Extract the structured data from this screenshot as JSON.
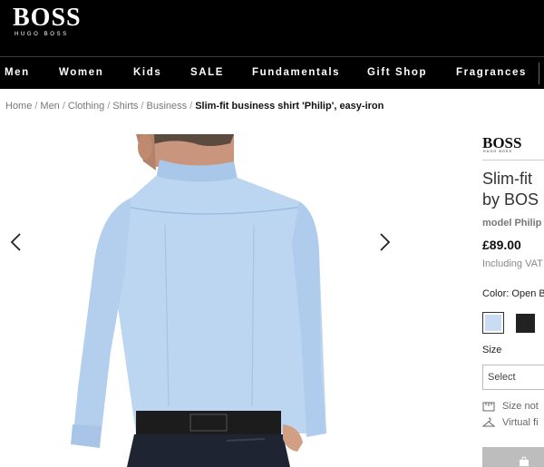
{
  "header": {
    "logo_main": "BOSS",
    "logo_sub": "HUGO BOSS"
  },
  "nav": {
    "items": [
      {
        "label": "Men"
      },
      {
        "label": "Women"
      },
      {
        "label": "Kids"
      },
      {
        "label": "SALE"
      },
      {
        "label": "Fundamentals"
      },
      {
        "label": "Gift Shop"
      },
      {
        "label": "Fragrances"
      }
    ]
  },
  "breadcrumb": {
    "items": [
      {
        "label": "Home"
      },
      {
        "label": "Men"
      },
      {
        "label": "Clothing"
      },
      {
        "label": "Shirts"
      },
      {
        "label": "Business"
      }
    ],
    "separator": "/",
    "current": "Slim-fit business shirt 'Philip', easy-iron"
  },
  "product": {
    "brand_logo": "BOSS",
    "brand_logo_sub": "HUGO BOSS",
    "title_line1": "Slim-fit",
    "title_line2": "by BOS",
    "model": "model Philip",
    "price": "£89.00",
    "vat": "Including VAT",
    "color_label": "Color: Open B",
    "size_label": "Size",
    "size_select": "Select",
    "size_help": "Size not",
    "virtual_fit": "Virtual fi",
    "icons": {
      "prev": "chevron-left-icon",
      "next": "chevron-right-icon",
      "size_help": "ruler-icon",
      "virtual_fit": "hanger-icon",
      "bag": "shopping-bag-icon"
    }
  },
  "colors": {
    "header_bg": "#000000",
    "shirt": "#bcd6f1",
    "swatch_light": "#c9dcf3",
    "swatch_dark": "#222222",
    "button": "#bdbdbd"
  }
}
